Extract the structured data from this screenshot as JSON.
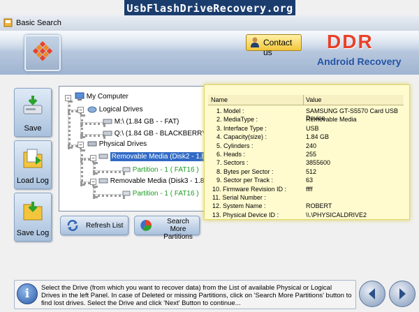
{
  "watermark": "UsbFlashDriveRecovery.org",
  "window": {
    "title": "Basic Search"
  },
  "header": {
    "contact_label": "Contact us",
    "brand": "DDR",
    "product": "Android Recovery"
  },
  "sidebar": {
    "items": [
      {
        "label": "Save"
      },
      {
        "label": "Load Log"
      },
      {
        "label": "Save Log"
      }
    ]
  },
  "tree": {
    "root": "My Computer",
    "logical": "Logical Drives",
    "m_drive": "M:\\ (1.84 GB - - FAT)",
    "q_drive": "Q:\\ (1.84 GB - BLACKBERRY - FAT)",
    "physical": "Physical Drives",
    "disk2": "Removable Media (Disk2 - 1.84 GB)",
    "disk2_part": "Partition - 1 ( FAT16 )",
    "disk3": "Removable Media (Disk3 - 1.83 GB)",
    "disk3_part": "Partition - 1 ( FAT16 )"
  },
  "table": {
    "headers": [
      "Name",
      "Value"
    ],
    "rows": [
      {
        "k": "1. Model :",
        "v": "SAMSUNG GT-S5570 Card USB Device"
      },
      {
        "k": "2. MediaType :",
        "v": "Removable Media"
      },
      {
        "k": "3. Interface Type :",
        "v": "USB"
      },
      {
        "k": "4. Capacity(size) :",
        "v": "1.84 GB"
      },
      {
        "k": "5. Cylinders :",
        "v": "240"
      },
      {
        "k": "6. Heads :",
        "v": "255"
      },
      {
        "k": "7. Sectors :",
        "v": "3855600"
      },
      {
        "k": "8. Bytes per Sector :",
        "v": "512"
      },
      {
        "k": "9. Sector per Track :",
        "v": "63"
      },
      {
        "k": "10. Firmware Revision ID :",
        "v": "ffff"
      },
      {
        "k": "11. Serial Number :",
        "v": ""
      },
      {
        "k": "12. System Name :",
        "v": "ROBERT"
      },
      {
        "k": "13. Physical Device ID :",
        "v": "\\\\.\\PHYSICALDRIVE2"
      }
    ]
  },
  "buttons": {
    "refresh": "Refresh List",
    "search_line1": "Search More",
    "search_line2": "Partitions"
  },
  "status": {
    "text": "Select the Drive (from which you want to recover data) from the List of available Physical or Logical Drives in the left Panel. In case of Deleted or missing Partitions, click on 'Search More Partitions' button to find lost drives. Select the Drive and click 'Next' Button to continue..."
  },
  "colors": {
    "brand": "#e9412a",
    "product": "#2353a6",
    "selection": "#316ac5",
    "partition": "#1b9a22",
    "table_bg": "#fffbcf"
  }
}
